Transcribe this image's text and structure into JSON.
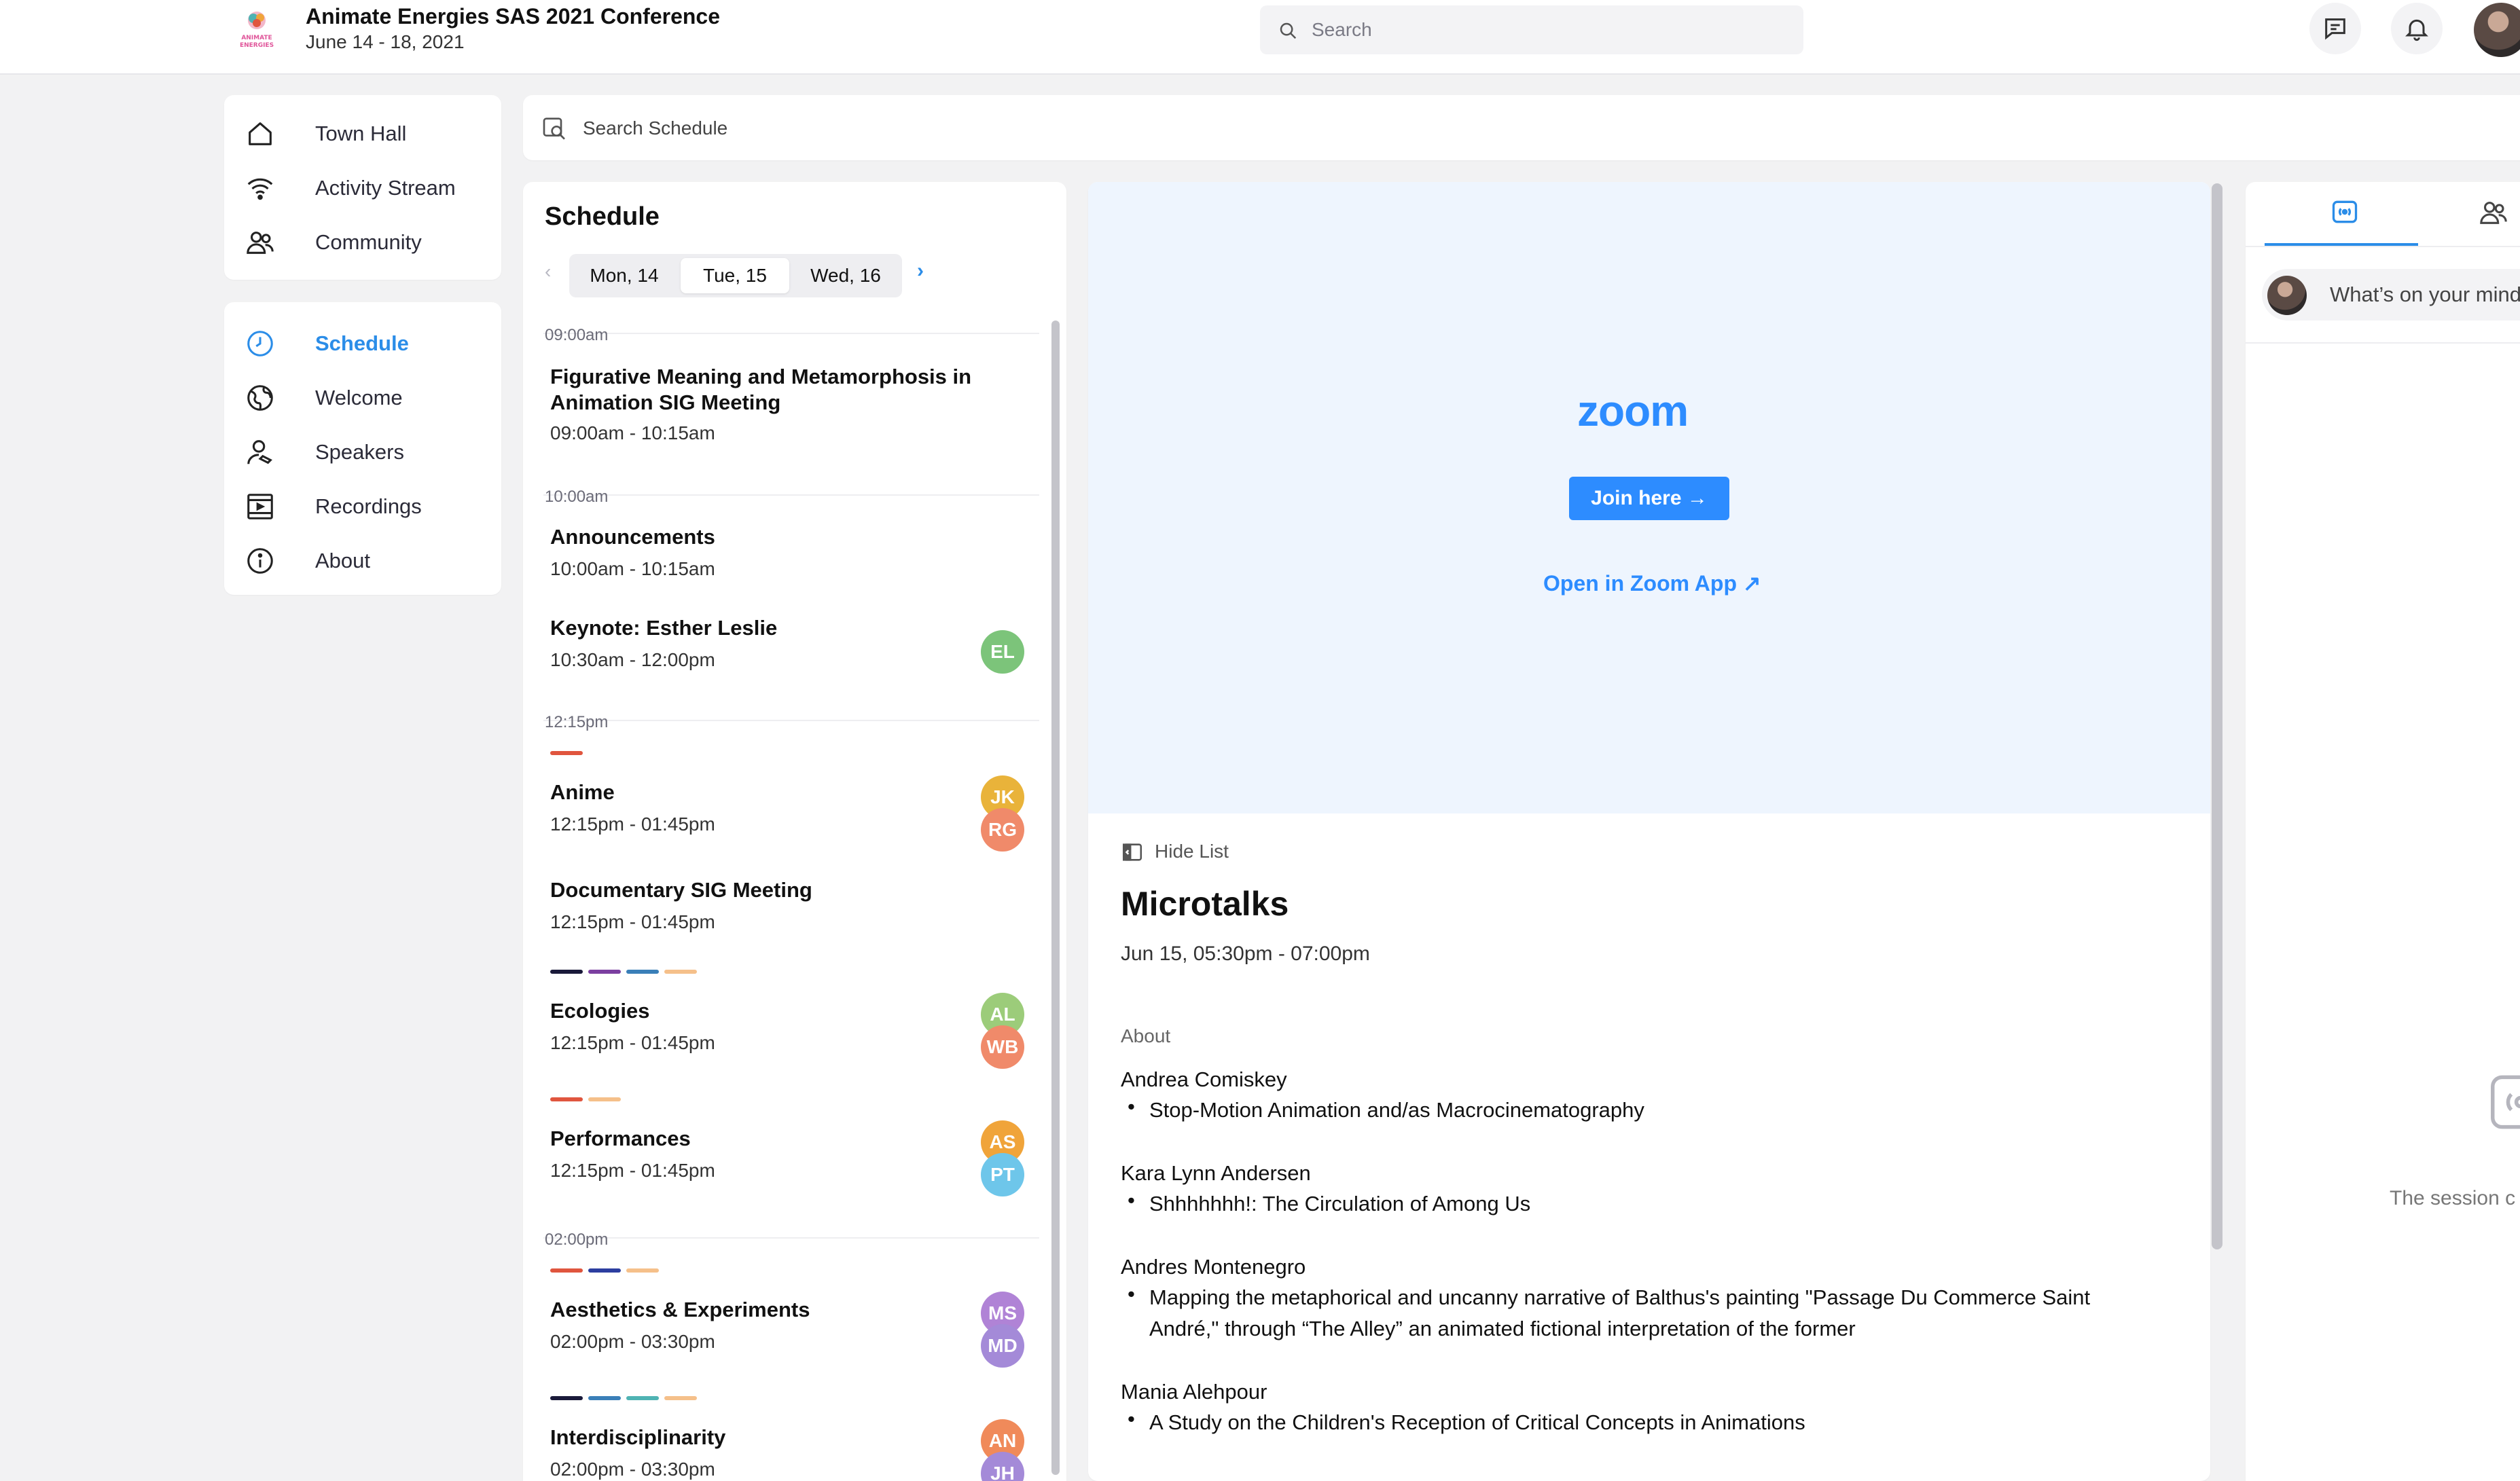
{
  "header": {
    "logo_text": "ANIMATE ENERGIES",
    "conference_title": "Animate Energies SAS 2021 Conference",
    "conference_dates": "June 14 - 18, 2021",
    "search_placeholder": "Search"
  },
  "nav": {
    "primary": [
      {
        "label": "Town Hall",
        "icon": "home-icon"
      },
      {
        "label": "Activity Stream",
        "icon": "wifi-icon"
      },
      {
        "label": "Community",
        "icon": "users-icon"
      }
    ],
    "secondary": [
      {
        "label": "Schedule",
        "icon": "clock-icon",
        "active": true
      },
      {
        "label": "Welcome",
        "icon": "globe-icon"
      },
      {
        "label": "Speakers",
        "icon": "speaker-icon"
      },
      {
        "label": "Recordings",
        "icon": "film-icon"
      },
      {
        "label": "About",
        "icon": "info-icon"
      }
    ]
  },
  "schedule_search": {
    "placeholder": "Search Schedule"
  },
  "schedule": {
    "title": "Schedule",
    "days": [
      "Mon, 14",
      "Tue, 15",
      "Wed, 16"
    ],
    "selected_day": "Tue, 15",
    "time_labels": [
      "09:00am",
      "10:00am",
      "12:15pm",
      "02:00pm"
    ],
    "events": [
      {
        "title": "Figurative Meaning and Metamorphosis in Animation SIG Meeting",
        "time": "09:00am - 10:15am",
        "avatars": []
      },
      {
        "title": "Announcements",
        "time": "10:00am - 10:15am",
        "avatars": []
      },
      {
        "title": "Keynote: Esther Leslie",
        "time": "10:30am - 12:00pm",
        "avatars": [
          {
            "initials": "EL",
            "color": "#7cc47a"
          }
        ]
      },
      {
        "title": "Anime",
        "time": "12:15pm - 01:45pm",
        "avatars": [
          {
            "initials": "JK",
            "color": "#e9b33a"
          },
          {
            "initials": "RG",
            "color": "#f08a6a"
          }
        ]
      },
      {
        "title": "Documentary SIG Meeting",
        "time": "12:15pm - 01:45pm",
        "avatars": []
      },
      {
        "title": "Ecologies",
        "time": "12:15pm - 01:45pm",
        "avatars": [
          {
            "initials": "AL",
            "color": "#9ccc7a"
          },
          {
            "initials": "WB",
            "color": "#f08a6a"
          }
        ]
      },
      {
        "title": "Performances",
        "time": "12:15pm - 01:45pm",
        "avatars": [
          {
            "initials": "AS",
            "color": "#f0a43a"
          },
          {
            "initials": "PT",
            "color": "#6ec6ea"
          }
        ]
      },
      {
        "title": "Aesthetics & Experiments",
        "time": "02:00pm - 03:30pm",
        "avatars": [
          {
            "initials": "MS",
            "color": "#b083d6"
          },
          {
            "initials": "MD",
            "color": "#a48ad8"
          }
        ]
      },
      {
        "title": "Interdisciplinarity",
        "time": "02:00pm - 03:30pm",
        "avatars": [
          {
            "initials": "AN",
            "color": "#f08a5a"
          },
          {
            "initials": "JH",
            "color": "#a48ad8"
          }
        ]
      }
    ],
    "tag_colors": {
      "red": "#e0553e",
      "purple": "#7b3fa0",
      "navy": "#1a1a3a",
      "blue": "#3a7fb8",
      "peach": "#f5c08a",
      "darkblue": "#2c3ea0",
      "teal": "#4fb3b3"
    }
  },
  "session": {
    "zoom_logo": "zoom",
    "join_label": "Join here →",
    "open_zoom_label": "Open in Zoom App ↗",
    "hide_list_label": "Hide List",
    "title": "Microtalks",
    "datetime": "Jun 15, 05:30pm - 07:00pm",
    "about_label": "About",
    "talks": [
      {
        "speaker": "Andrea Comiskey",
        "title": "Stop-Motion Animation and/as Macrocinematography"
      },
      {
        "speaker": "Kara Lynn Andersen",
        "title": "Shhhhhhh!: The Circulation of Among Us"
      },
      {
        "speaker": "Andres Montenegro",
        "title": "Mapping the metaphorical and uncanny narrative of Balthus's painting \"Passage Du Commerce Saint André,\" through “The Alley” an animated fictional interpretation of the former"
      },
      {
        "speaker": "Mania Alehpour",
        "title": "A Study on the Children's Reception of Critical Concepts in Animations"
      }
    ]
  },
  "right_panel": {
    "post_placeholder": "What’s on your mind",
    "empty_text": "The session c"
  },
  "colors": {
    "accent": "#2b8de8",
    "zoom_blue": "#2d8cff",
    "zoom_bg": "#eef5fe"
  }
}
